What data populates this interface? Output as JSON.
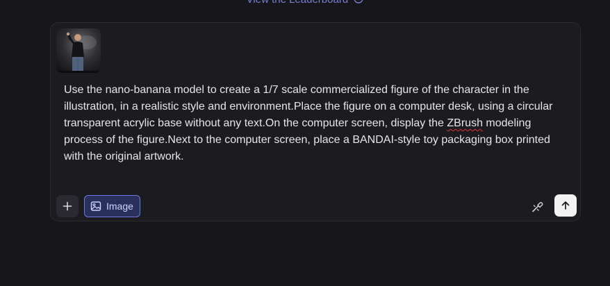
{
  "header": {
    "link_label": "View the Leaderboard"
  },
  "composer": {
    "prompt_part1": "Use the nano-banana model to create a 1/7 scale commercialized figure of the character in the illustration, in a realistic style and environment.Place the figure on a computer desk, using a circular transparent acrylic base without any text.On the computer screen, display the ",
    "prompt_flagged_word": "ZBrush",
    "prompt_part2": " modeling process of the figure.Next to the computer screen, place a BANDAI-style toy packaging box printed with the original artwork.",
    "attachment_icon": "photo-thumbnail",
    "add_icon": "plus-icon",
    "mode_chip_label": "Image",
    "mode_chip_icon": "image-icon",
    "tool_icon": "wand-icon",
    "send_icon": "arrow-up-icon"
  },
  "colors": {
    "background": "#17171b",
    "panel": "#1c1c20",
    "accent": "#6d78e0",
    "link": "#7b7fd6"
  }
}
